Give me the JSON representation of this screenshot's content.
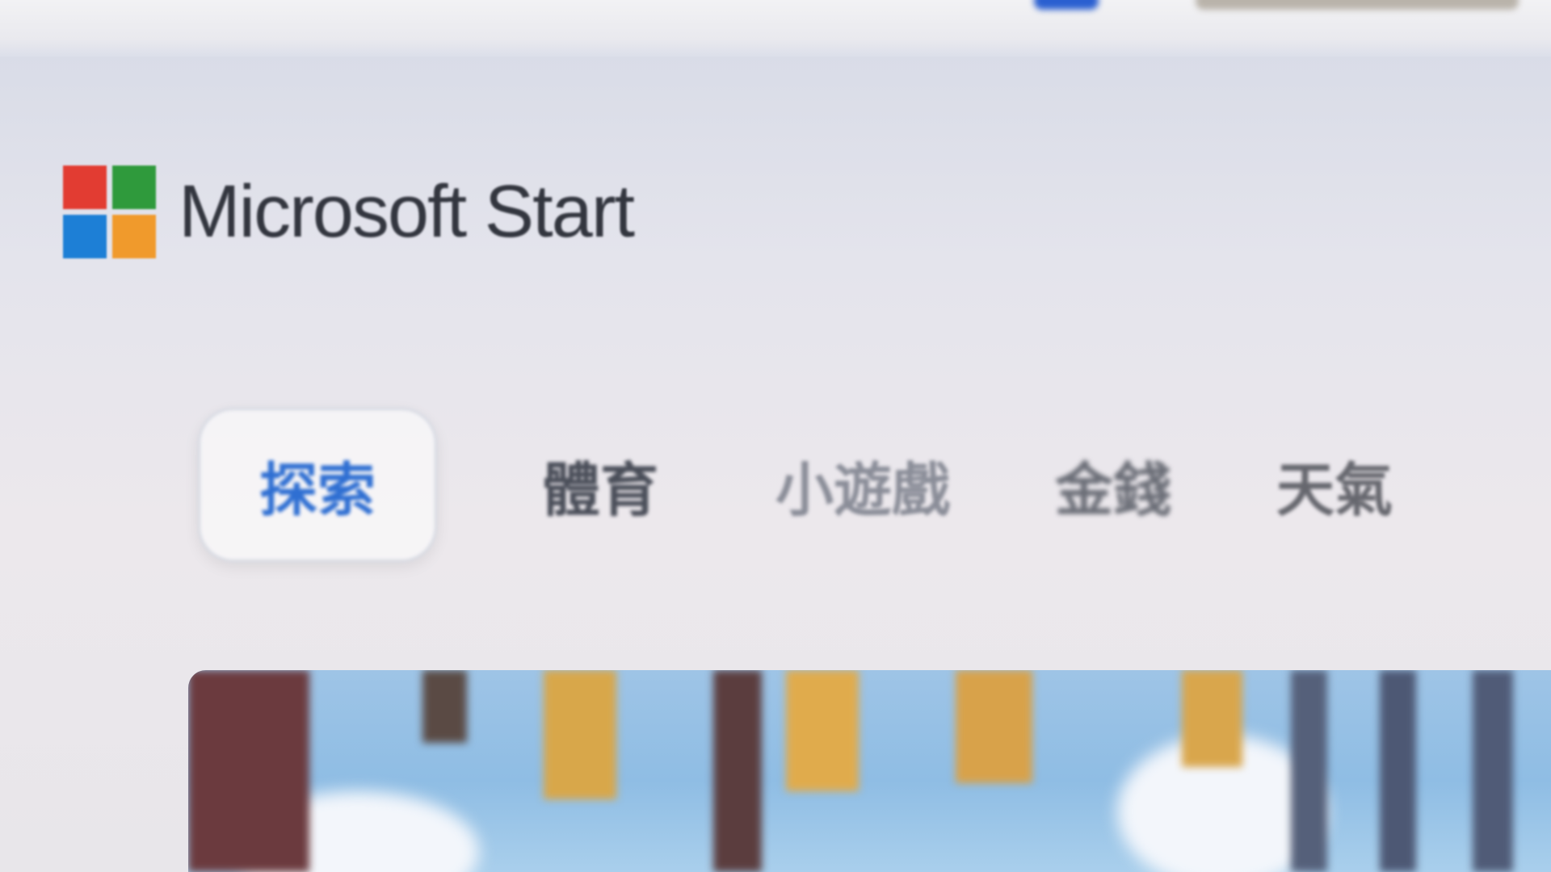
{
  "brand": {
    "name": "Microsoft Start",
    "logo_colors": [
      "#e23c32",
      "#2f9a3c",
      "#1d7fd6",
      "#f09a2c"
    ]
  },
  "tabs": [
    {
      "label": "探索",
      "active": true
    },
    {
      "label": "體育",
      "active": false
    },
    {
      "label": "小遊戲",
      "active": false
    },
    {
      "label": "金錢",
      "active": false
    },
    {
      "label": "天氣",
      "active": false
    }
  ],
  "colors": {
    "accent": "#2f6fd2",
    "text": "#33363f"
  }
}
